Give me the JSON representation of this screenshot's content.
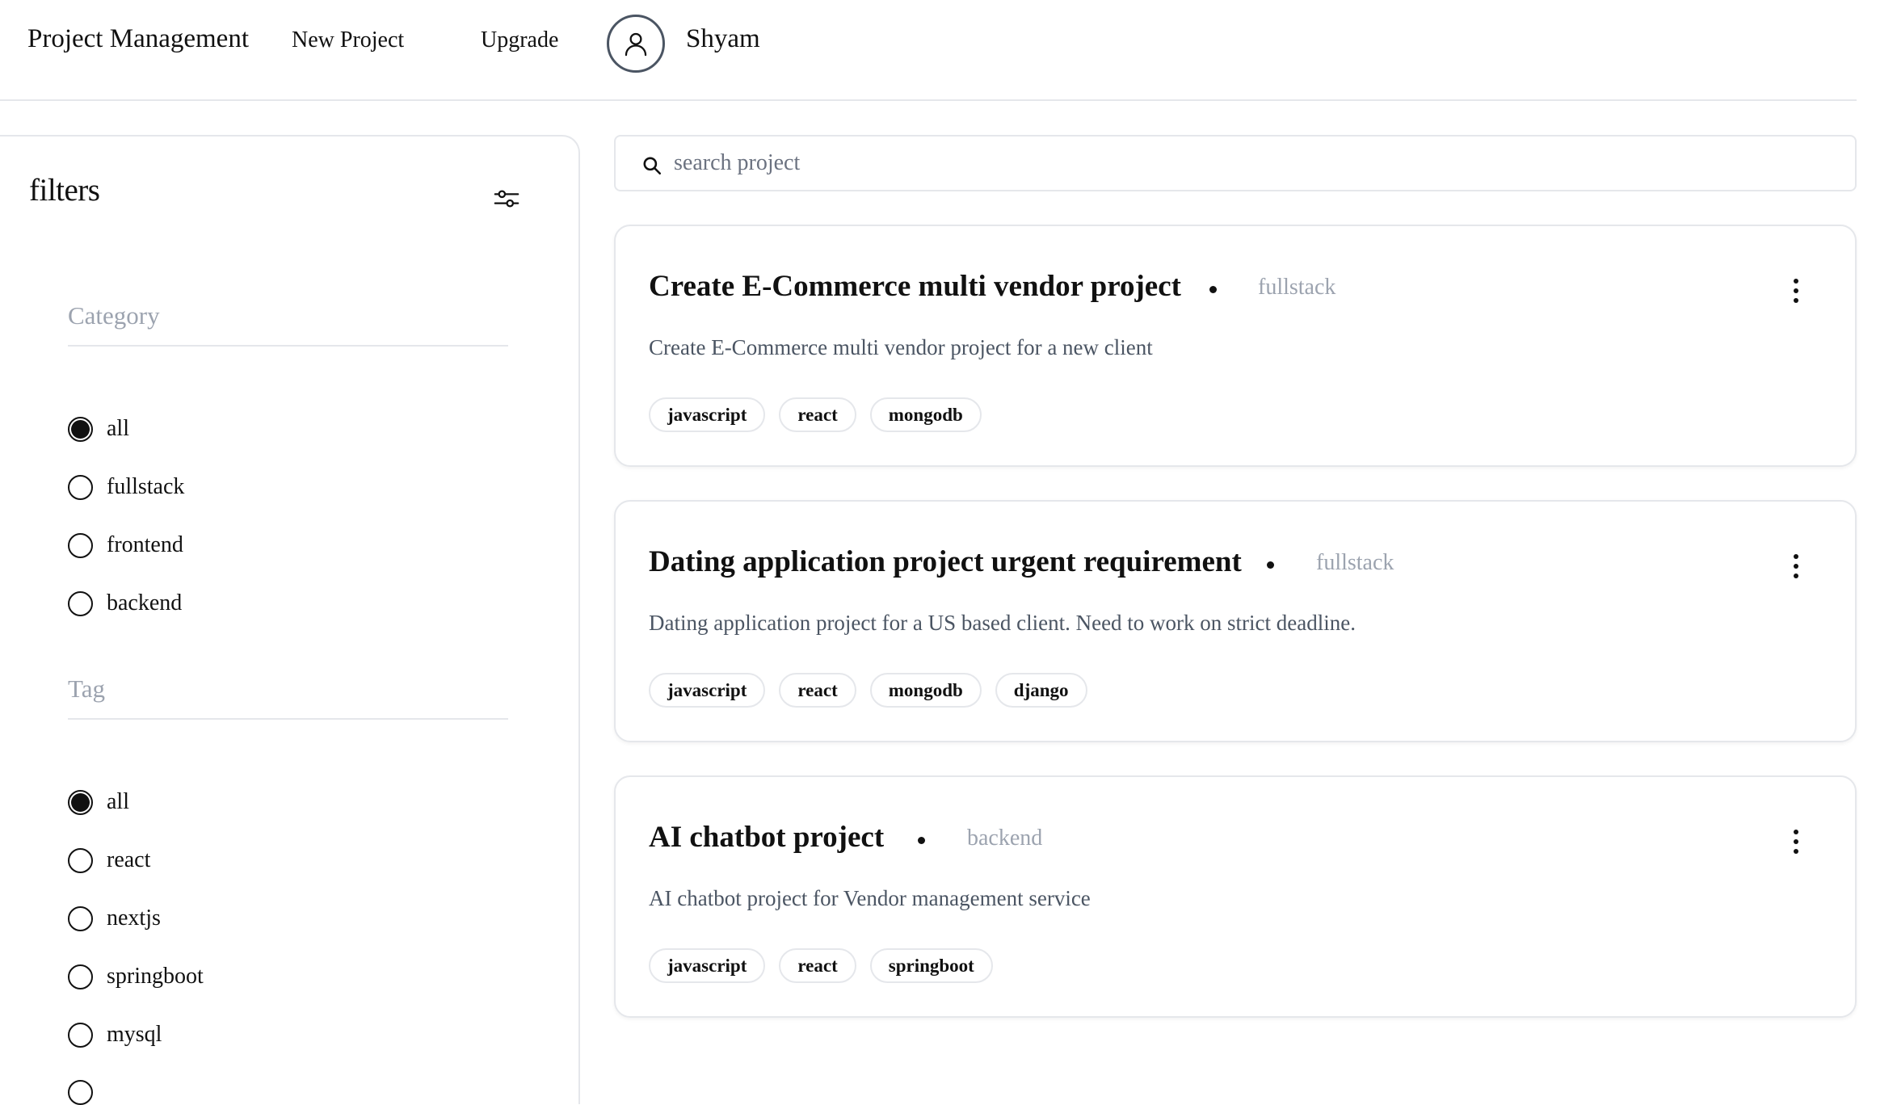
{
  "navbar": {
    "brand": "Project Management",
    "new_project": "New Project",
    "upgrade": "Upgrade",
    "user_name": "Shyam"
  },
  "filters": {
    "title": "filters",
    "category": {
      "title": "Category",
      "options": [
        {
          "label": "all",
          "checked": true
        },
        {
          "label": "fullstack",
          "checked": false
        },
        {
          "label": "frontend",
          "checked": false
        },
        {
          "label": "backend",
          "checked": false
        }
      ]
    },
    "tag": {
      "title": "Tag",
      "options": [
        {
          "label": "all",
          "checked": true
        },
        {
          "label": "react",
          "checked": false
        },
        {
          "label": "nextjs",
          "checked": false
        },
        {
          "label": "springboot",
          "checked": false
        },
        {
          "label": "mysql",
          "checked": false
        }
      ]
    }
  },
  "search": {
    "placeholder": "search project",
    "value": ""
  },
  "projects": [
    {
      "title": "Create E-Commerce multi vendor project",
      "category": "fullstack",
      "description": "Create E-Commerce multi vendor project for a new client",
      "tags": [
        "javascript",
        "react",
        "mongodb"
      ]
    },
    {
      "title": "Dating application project urgent requirement",
      "category": "fullstack",
      "description": "Dating application project for a US based client. Need to work on strict deadline.",
      "tags": [
        "javascript",
        "react",
        "mongodb",
        "django"
      ]
    },
    {
      "title": "AI chatbot project",
      "category": "backend",
      "description": "AI chatbot project for Vendor management service",
      "tags": [
        "javascript",
        "react",
        "springboot"
      ]
    }
  ]
}
